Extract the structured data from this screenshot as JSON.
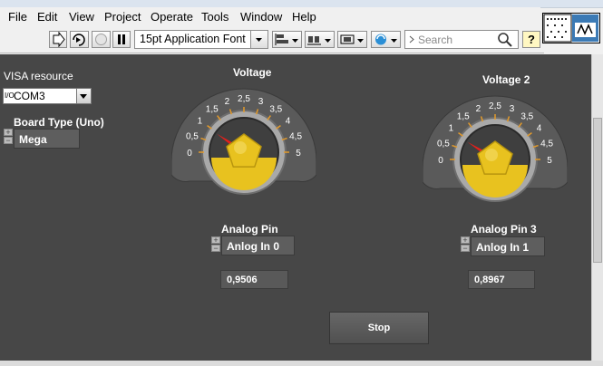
{
  "menu": [
    "File",
    "Edit",
    "View",
    "Project",
    "Operate",
    "Tools",
    "Window",
    "Help"
  ],
  "toolbar": {
    "font_label": "15pt Application Font",
    "search_placeholder": "Search",
    "help_label": "?"
  },
  "panel": {
    "visa_label": "VISA resource",
    "visa_prefix": "I/O",
    "visa_value": "COM3",
    "board_label": "Board Type (Uno)",
    "board_value": "Mega",
    "gauges": [
      {
        "title": "Voltage",
        "ticks": [
          "0",
          "0,5",
          "1",
          "1,5",
          "2",
          "2,5",
          "3",
          "3,5",
          "4",
          "4,5",
          "5"
        ],
        "min": 0,
        "max": 5,
        "value": 0.9506
      },
      {
        "title": "Voltage 2",
        "ticks": [
          "0",
          "0,5",
          "1",
          "1,5",
          "2",
          "2,5",
          "3",
          "3,5",
          "4",
          "4,5",
          "5"
        ],
        "min": 0,
        "max": 5,
        "value": 0.8967
      }
    ],
    "pin1_label": "Analog Pin",
    "pin1_value": "Anlog In 0",
    "num1": "0,9506",
    "pin2_label": "Analog Pin 3",
    "pin2_value": "Anlog In 1",
    "num2": "0,8967",
    "stop_label": "Stop",
    "ring_plus": "+",
    "ring_minus": "−"
  },
  "colors": {
    "panel": "#474747",
    "knob": "#e8c21f",
    "needle": "#e3201c",
    "tick": "#e39a2b"
  }
}
